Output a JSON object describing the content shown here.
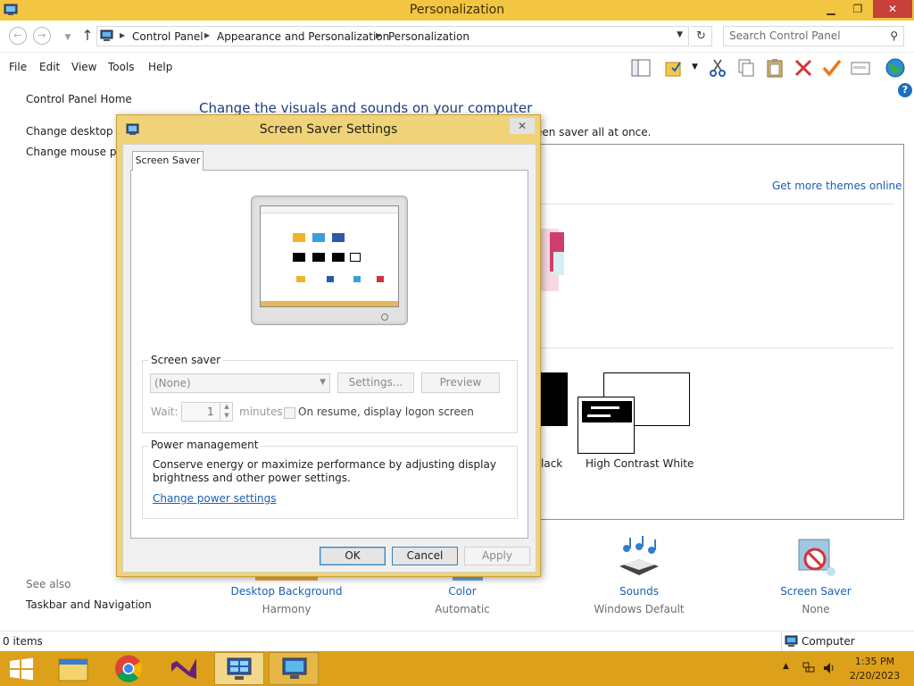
{
  "window": {
    "title": "Personalization",
    "controls": {
      "minimize": "▁",
      "maximize": "❐",
      "close": "✕"
    }
  },
  "address_bar": {
    "breadcrumbs": [
      "Control Panel",
      "Appearance and Personalization",
      "Personalization"
    ],
    "search_placeholder": "Search Control Panel"
  },
  "menu": [
    "File",
    "Edit",
    "View",
    "Tools",
    "Help"
  ],
  "toolbar_icons": [
    "layout-icon",
    "folder-check-icon",
    "scissors-icon",
    "copy-icon",
    "paste-icon",
    "delete-icon",
    "checkmark-icon",
    "properties-icon",
    "globe-icon"
  ],
  "left_nav": {
    "home": "Control Panel Home",
    "links": [
      "Change desktop ico",
      "Change mouse poi"
    ],
    "see_also_heading": "See also",
    "see_also_links": [
      "Taskbar and Navigation"
    ]
  },
  "main": {
    "heading": "Change the visuals and sounds on your computer",
    "description_fragment": "een saver all at once.",
    "get_more_link": "Get more themes online",
    "theme_labels": [
      "lack",
      "High Contrast White"
    ]
  },
  "bottom_items": [
    {
      "label": "Desktop Background",
      "sub": "Harmony"
    },
    {
      "label": "Color",
      "sub": "Automatic"
    },
    {
      "label": "Sounds",
      "sub": "Windows Default"
    },
    {
      "label": "Screen Saver",
      "sub": "None"
    }
  ],
  "status_bar": {
    "items_count": "0 items",
    "location": "Computer"
  },
  "taskbar": {
    "time": "1:35 PM",
    "date": "2/20/2023",
    "apps": [
      "windows-start-icon",
      "file-explorer-icon",
      "chrome-icon",
      "visual-studio-icon",
      "control-panel-icon",
      "personalization-icon"
    ]
  },
  "dialog": {
    "title": "Screen Saver Settings",
    "close": "✕",
    "tab": "Screen Saver",
    "screen_saver_group": "Screen saver",
    "screen_saver_value": "(None)",
    "settings_button": "Settings...",
    "preview_button": "Preview",
    "wait_label": "Wait:",
    "wait_value": "1",
    "minutes_label": "minutes",
    "resume_label": "On resume, display logon screen",
    "power_group": "Power management",
    "power_text_line1": "Conserve energy or maximize performance by adjusting display",
    "power_text_line2": "brightness and other power settings.",
    "power_link": "Change power settings",
    "ok": "OK",
    "cancel": "Cancel",
    "apply": "Apply"
  }
}
